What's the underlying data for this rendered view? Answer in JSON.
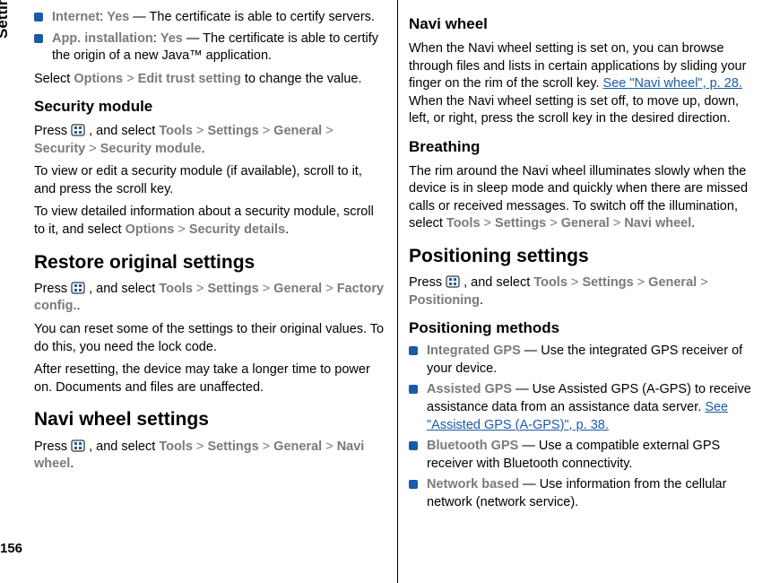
{
  "sidebar": {
    "label": "Settings",
    "pageNumber": "156"
  },
  "col1": {
    "internetItem": {
      "label": "Internet",
      "value": "Yes",
      "desc": " — The certificate is able to certify servers."
    },
    "appItem": {
      "label": "App. installation",
      "value": "Yes",
      "desc": " — The certificate is able to certify the origin of a new Java™ application."
    },
    "selectPrefix": "Select ",
    "optionsWord": "Options",
    "gt": " > ",
    "editTrust": "Edit trust setting",
    "selectSuffix": " to change the value.",
    "secModHeading": "Security module",
    "press": "Press ",
    "andSelect": " , and select ",
    "tools": "Tools",
    "settings": "Settings",
    "general": "General",
    "security": "Security",
    "securityModule": "Security module",
    "dot": ".",
    "secModP1": "To view or edit a security module (if available), scroll to it, and press the scroll key.",
    "secModP2a": "To view detailed information about a security module, scroll to it, and select ",
    "securityDetails": "Security details",
    "restoreHeading": "Restore original settings",
    "factoryConfig": "Factory config.",
    "restoreP1": "You can reset some of the settings to their original values. To do this, you need the lock code.",
    "restoreP2": "After resetting, the device may take a longer time to power on. Documents and files are unaffected.",
    "naviHeading": "Navi wheel settings",
    "naviWheel": "Navi wheel"
  },
  "col2": {
    "naviWheelH": "Navi wheel",
    "naviP1a": "When the Navi wheel setting is set on, you can browse through files and lists in certain applications by sliding your finger on the rim of the scroll key. ",
    "naviLink": "See \"Navi wheel\", p. 28.",
    "naviP1b": " When the Navi wheel setting is set off, to move up, down, left, or right, press the scroll key in the desired direction.",
    "breathingH": "Breathing",
    "breathP1a": "The rim around the Navi wheel illuminates slowly when the device is in sleep mode and quickly when there are missed calls or received messages. To switch off the illumination, select ",
    "tools": "Tools",
    "gt": " > ",
    "settings": "Settings",
    "general": "General",
    "naviWheel": "Navi wheel",
    "dot": ".",
    "posHeading": "Positioning settings",
    "press": "Press ",
    "andSelect": " , and select ",
    "positioning": "Positioning",
    "posMethodsH": "Positioning methods",
    "items": [
      {
        "label": "Integrated GPS ",
        "desc": " — Use the integrated GPS receiver of your device."
      },
      {
        "label": "Assisted GPS ",
        "desc": " — Use Assisted GPS (A-GPS) to receive assistance data from an assistance data server. ",
        "link": "See \"Assisted GPS (A-GPS)\", p. 38."
      },
      {
        "label": "Bluetooth GPS",
        "desc": " — Use a compatible external GPS receiver with Bluetooth connectivity."
      },
      {
        "label": "Network based ",
        "desc": " — Use information from the cellular network (network service)."
      }
    ]
  }
}
